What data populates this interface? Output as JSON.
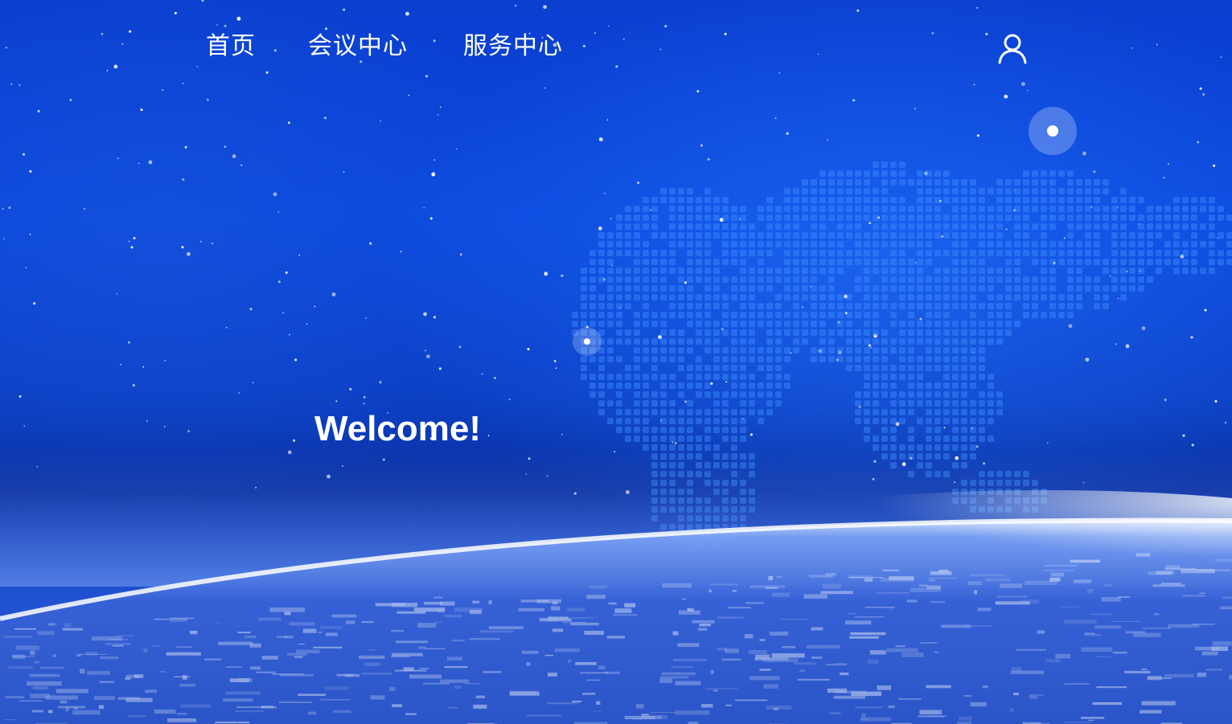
{
  "nav": {
    "items": [
      {
        "label": "首页"
      },
      {
        "label": "会议中心"
      },
      {
        "label": "服务中心"
      }
    ],
    "user_icon": "user-icon"
  },
  "hero": {
    "welcome_text": "Welcome!"
  },
  "colors": {
    "background_primary": "#0a47dd",
    "background_dark": "#0a2f9e",
    "text": "#ffffff",
    "map_dots": "#3f8cff",
    "earth_glow": "#e8f0ff"
  }
}
